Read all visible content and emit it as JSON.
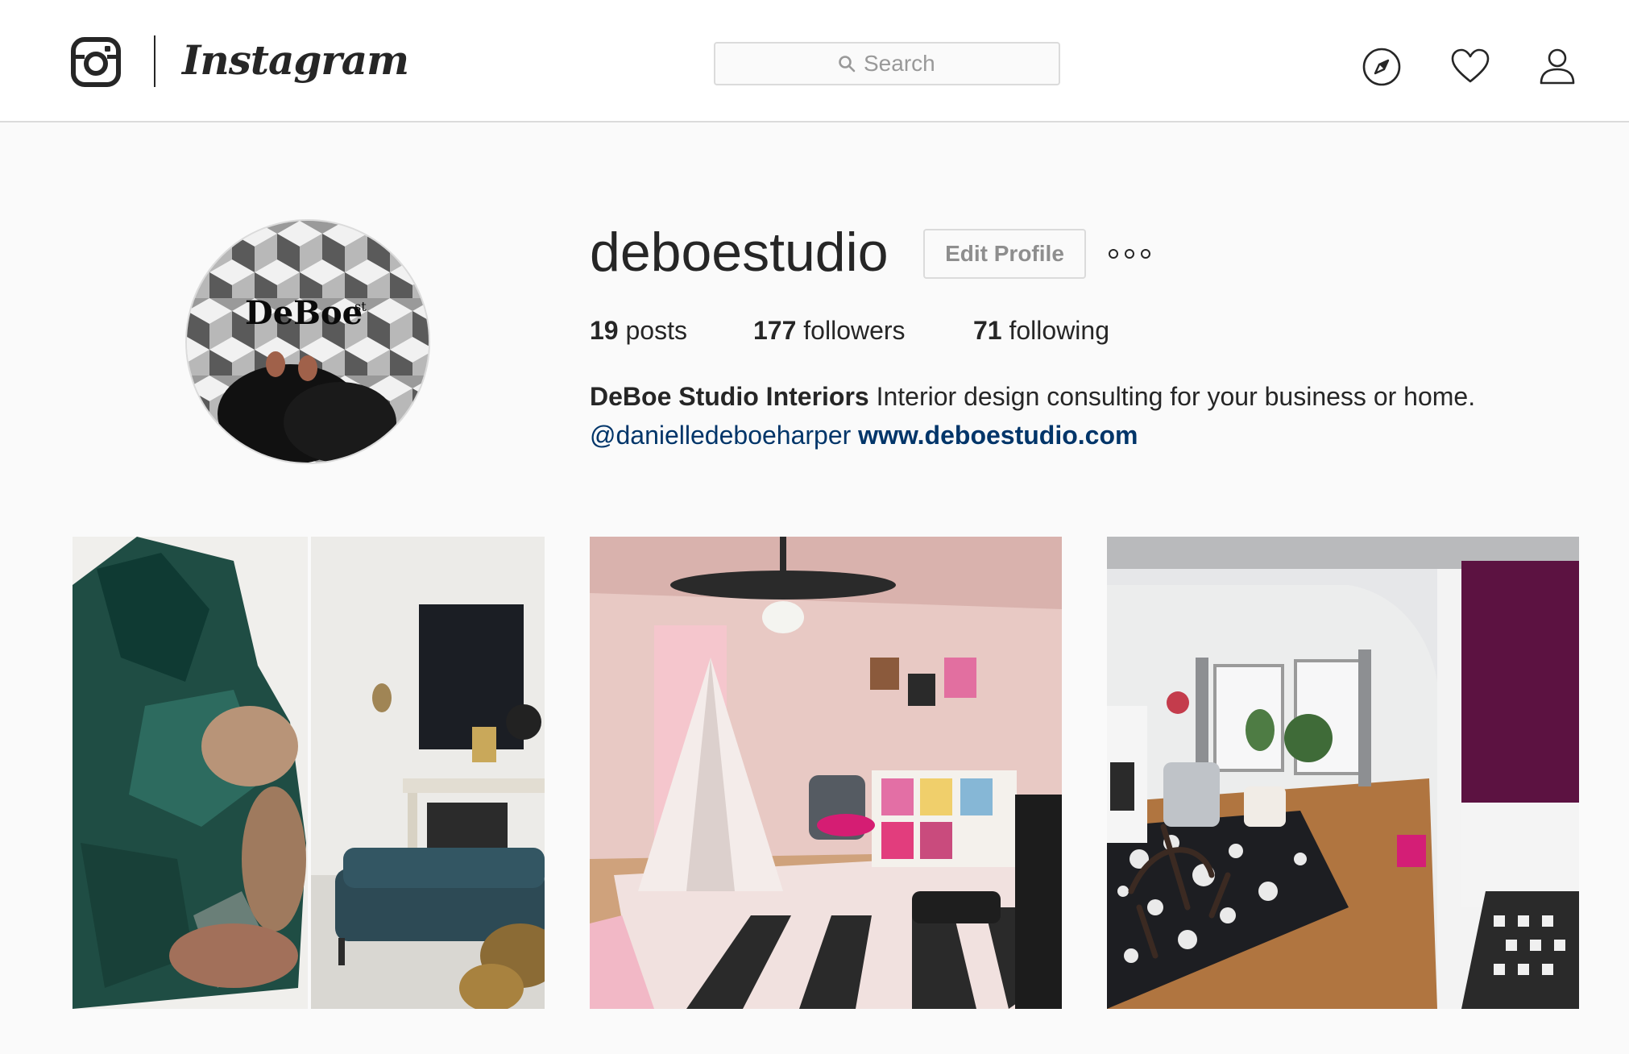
{
  "header": {
    "logo_text": "Instagram",
    "search": {
      "placeholder": "Search"
    },
    "nav": [
      {
        "icon": "compass-icon",
        "label": "Explore"
      },
      {
        "icon": "heart-icon",
        "label": "Activity"
      },
      {
        "icon": "person-icon",
        "label": "Profile"
      }
    ]
  },
  "profile": {
    "avatar_text": "DeBoe",
    "avatar_superscript": "st",
    "username": "deboestudio",
    "edit_button": "Edit Profile",
    "stats": {
      "posts_count": "19",
      "posts_label": "posts",
      "followers_count": "177",
      "followers_label": "followers",
      "following_count": "71",
      "following_label": "following"
    },
    "bio": {
      "name": "DeBoe Studio Interiors",
      "text": "Interior design consulting for your business or home.",
      "mention": "@danielledeboeharper",
      "link": "www.deboestudio.com"
    }
  },
  "posts": [
    {
      "subject": "Green crystal mineral and living room with teal tufted sofa"
    },
    {
      "subject": "Pink girls bedroom with teepee and striped rug"
    },
    {
      "subject": "Living room with rocking chair and patterned rug"
    }
  ],
  "colors": {
    "background": "#fafafa",
    "border": "#dbdbdb",
    "text": "#262626",
    "link": "#003569",
    "muted": "#8e8e8e"
  }
}
